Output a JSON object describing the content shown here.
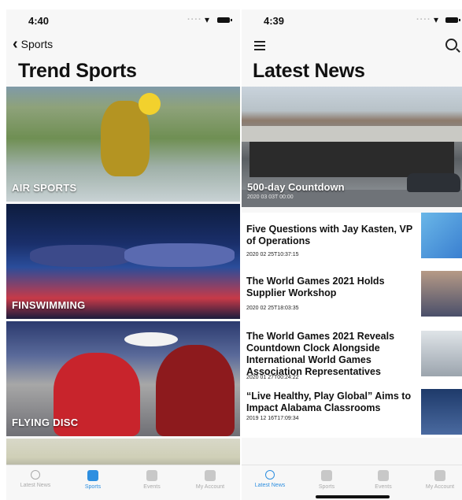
{
  "left": {
    "status": {
      "time": "4:40"
    },
    "back_label": "Sports",
    "title": "Trend Sports",
    "categories": [
      {
        "label": "AIR SPORTS"
      },
      {
        "label": "FINSWIMMING"
      },
      {
        "label": "FLYING DISC"
      }
    ]
  },
  "right": {
    "status": {
      "time": "4:39"
    },
    "title": "Latest News",
    "hero": {
      "title": "500-day Countdown",
      "date": "2020 03 03T 00:00"
    },
    "news": [
      {
        "title": "Five Questions with Jay Kasten, VP of Operations",
        "date": "2020 02 25T10:37:15"
      },
      {
        "title": "The World Games 2021 Holds Supplier Workshop",
        "date": "2020 02 25T18:03:35"
      },
      {
        "title": "The World Games 2021 Reveals Countdown Clock Alongside International World Games Association Representatives",
        "date": "2020 01 27T00:24:22"
      },
      {
        "title": "“Live Healthy, Play Global” Aims to Impact Alabama Classrooms",
        "date": "2019 12 16T17:09:34"
      }
    ]
  },
  "tabs": [
    {
      "label": "Latest News",
      "icon": "clock-icon"
    },
    {
      "label": "Sports",
      "icon": "sports-icon"
    },
    {
      "label": "Events",
      "icon": "calendar-icon"
    },
    {
      "label": "My Account",
      "icon": "account-icon"
    }
  ],
  "active_tab": {
    "left": "Sports",
    "right": "Latest News"
  },
  "colors": {
    "accent": "#2e8fe0",
    "inactive_tab": "#aaaaaa"
  }
}
